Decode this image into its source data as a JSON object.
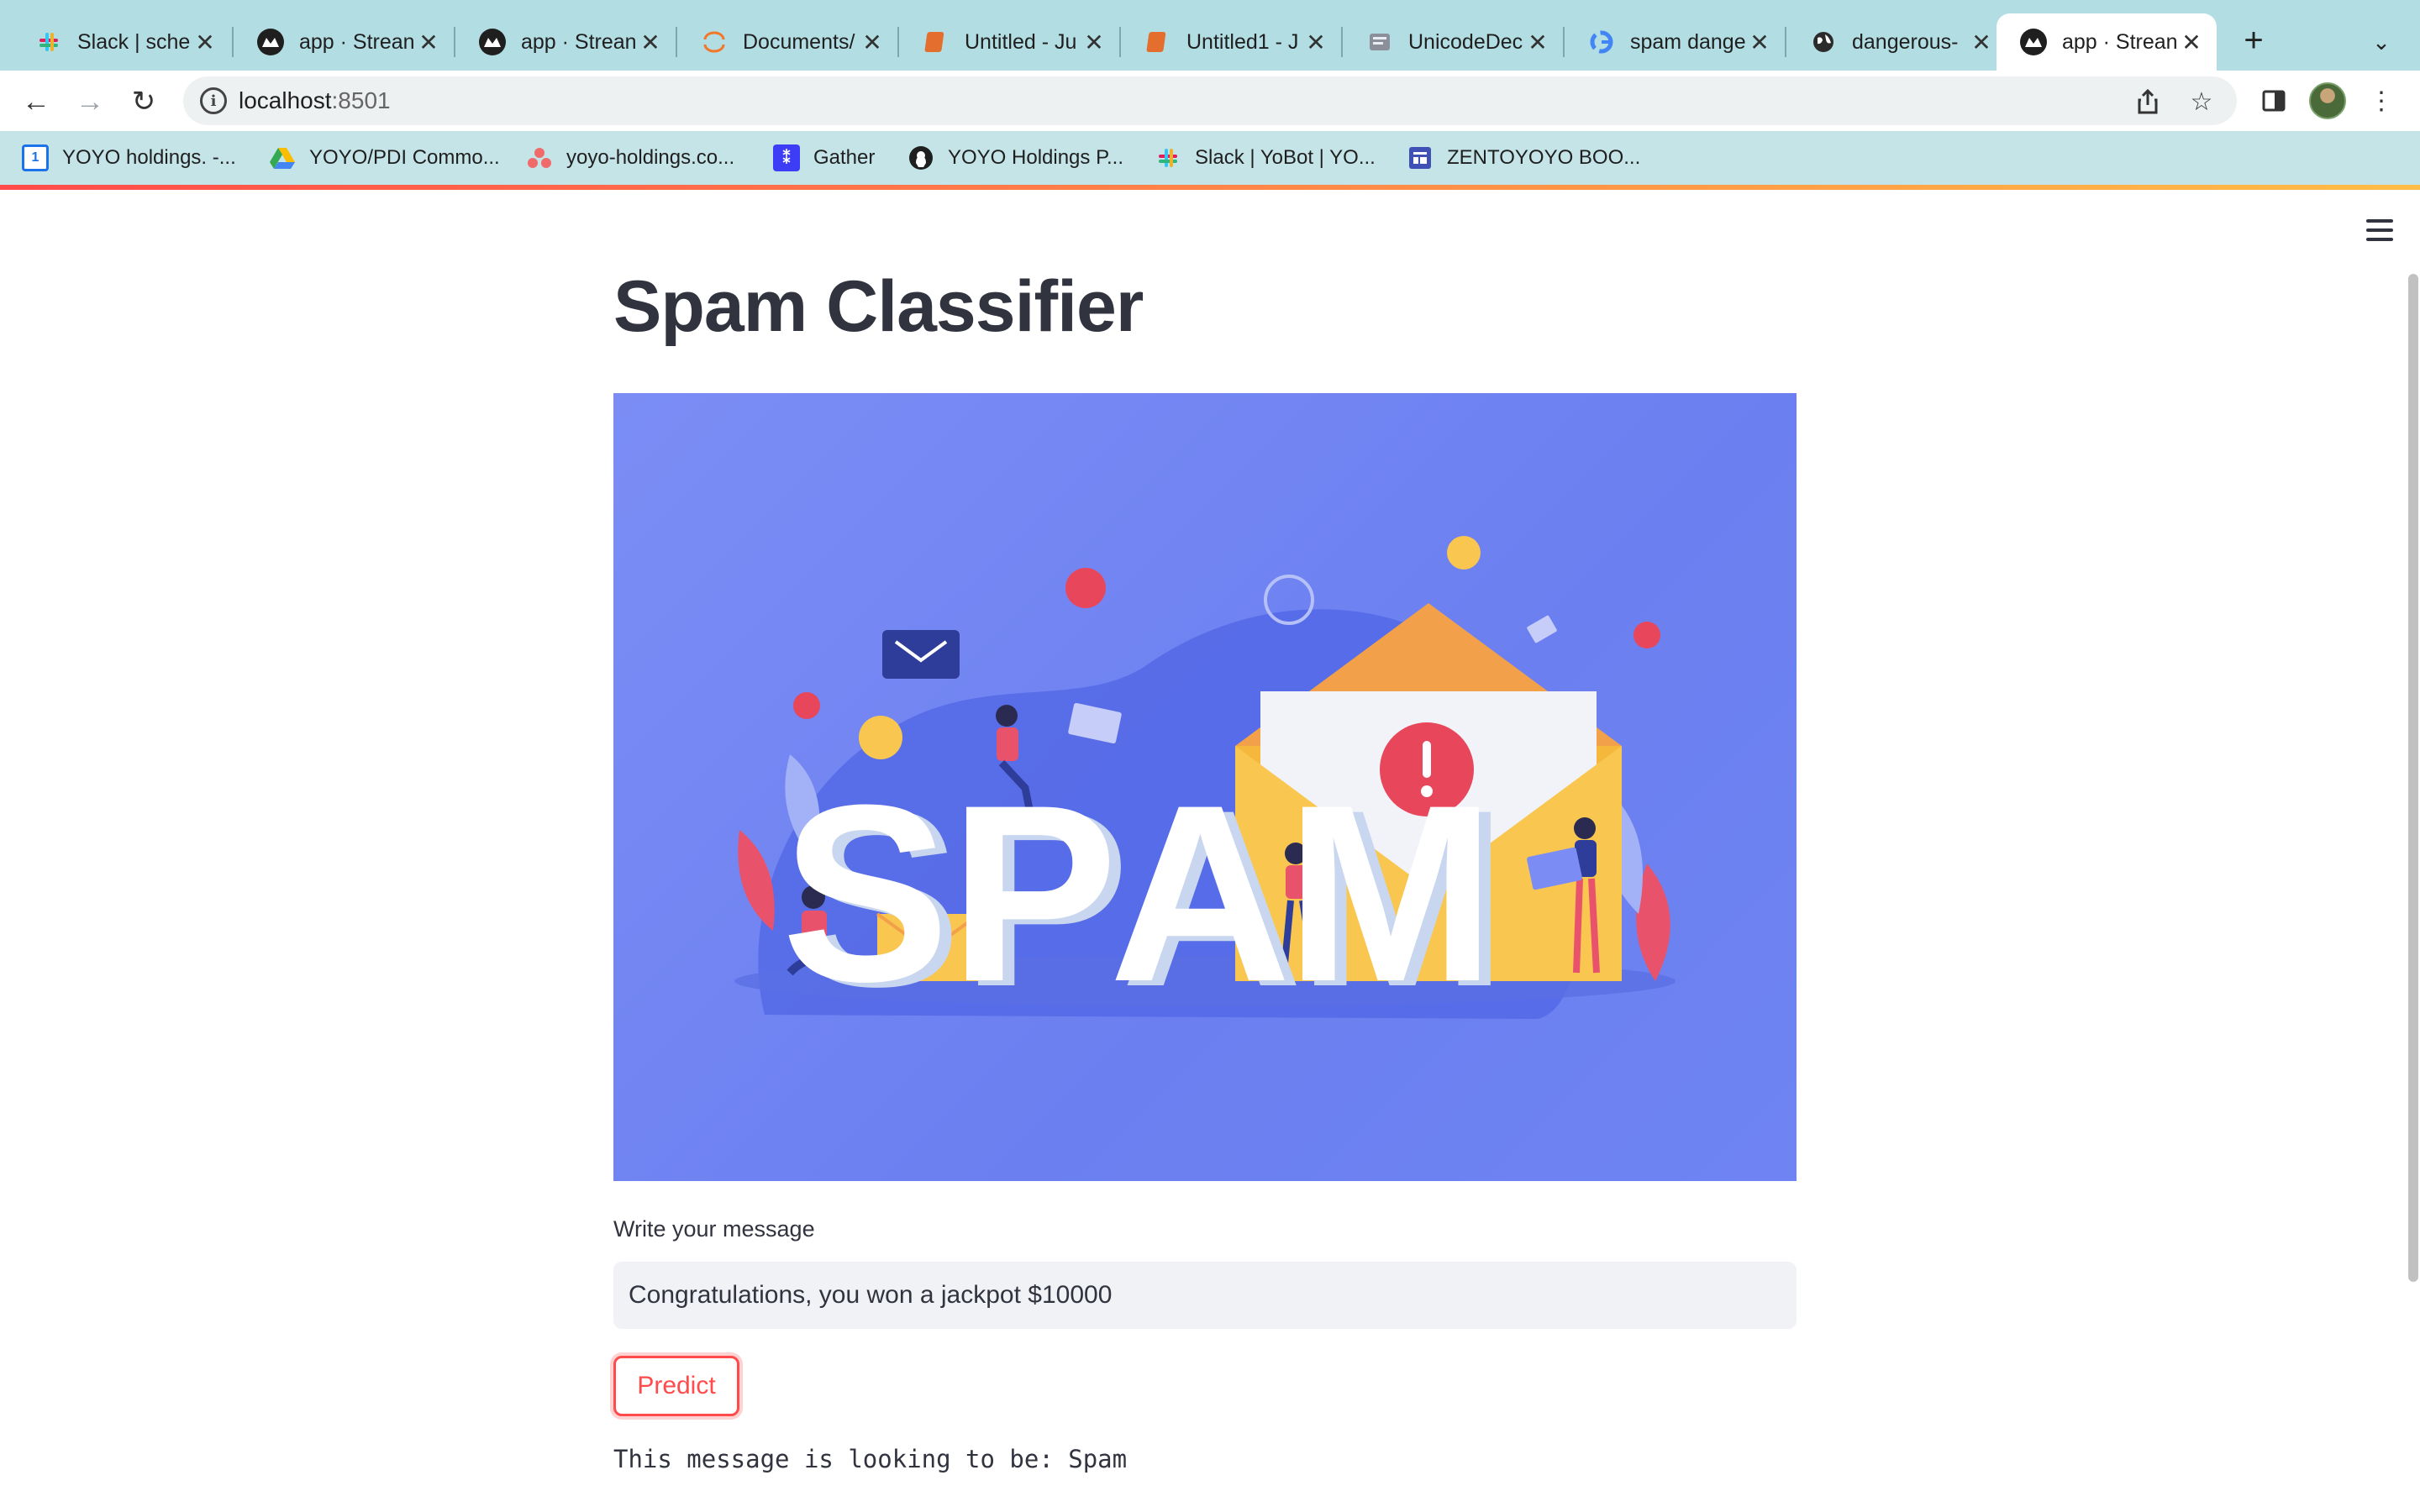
{
  "browser": {
    "tabs": [
      {
        "title": "Slack | sche",
        "icon": "slack-icon",
        "active": false
      },
      {
        "title": "app · Strean",
        "icon": "streamlit-icon",
        "active": false
      },
      {
        "title": "app · Strean",
        "icon": "streamlit-icon",
        "active": false
      },
      {
        "title": "Documents/",
        "icon": "jupyter-icon",
        "active": false
      },
      {
        "title": "Untitled - Ju",
        "icon": "notebook-icon",
        "active": false
      },
      {
        "title": "Untitled1 - J",
        "icon": "notebook-icon",
        "active": false
      },
      {
        "title": "UnicodeDec",
        "icon": "python-docs-icon",
        "active": false
      },
      {
        "title": "spam dange",
        "icon": "google-icon",
        "active": false
      },
      {
        "title": "dangerous-",
        "icon": "globe-icon",
        "active": false
      },
      {
        "title": "app · Strean",
        "icon": "streamlit-icon",
        "active": true
      }
    ],
    "url_host": "localhost",
    "url_port": ":8501",
    "bookmarks": [
      {
        "label": "YOYO holdings. -...",
        "icon": "calendar-icon"
      },
      {
        "label": "YOYO/PDI Commo...",
        "icon": "google-drive-icon"
      },
      {
        "label": "yoyo-holdings.co...",
        "icon": "asana-icon"
      },
      {
        "label": "Gather",
        "icon": "gather-icon"
      },
      {
        "label": "YOYO Holdings P...",
        "icon": "github-icon"
      },
      {
        "label": "Slack | YoBot | YO...",
        "icon": "slack-icon"
      },
      {
        "label": "ZENTOYOYO BOO...",
        "icon": "forms-icon"
      }
    ]
  },
  "app": {
    "title": "Spam Classifier",
    "hero_text": [
      "S",
      "P",
      "A",
      "M"
    ],
    "input_label": "Write your message",
    "input_value": "Congratulations, you won a jackpot $10000",
    "predict_label": "Predict",
    "result": "This message is looking to be: Spam"
  },
  "colors": {
    "accent": "#ff4b4b",
    "hero_background": "#7385f3",
    "tabstrip": "#b2dde3",
    "bookmarks_bar": "#c4e4e8"
  }
}
